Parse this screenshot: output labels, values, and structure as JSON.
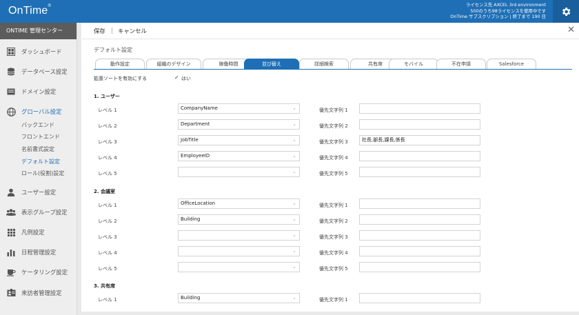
{
  "header": {
    "logo": "OnTime",
    "logo_mark": "®",
    "license_lines": [
      "ライセンス先 AXCEL 3rd environment",
      "500のうち98ライセンスを使用中です",
      "OnTime サブスクリプション | 終了まで 190 日"
    ],
    "settings_icon": "gear-icon"
  },
  "sidebar": {
    "title": "ONTIME 管理センター",
    "items": [
      {
        "label": "ダッシュボード",
        "icon": "dashboard-icon"
      },
      {
        "label": "データベース設定",
        "icon": "database-icon"
      },
      {
        "label": "ドメイン設定",
        "icon": "domain-icon"
      },
      {
        "label": "グローバル設定",
        "icon": "globe-icon"
      },
      {
        "label": "ユーザー設定",
        "icon": "user-icon"
      },
      {
        "label": "表示グループ設定",
        "icon": "group-icon"
      },
      {
        "label": "凡例設定",
        "icon": "legend-icon"
      },
      {
        "label": "日程管理設定",
        "icon": "chart-icon"
      },
      {
        "label": "ケータリング設定",
        "icon": "coffee-icon"
      },
      {
        "label": "来訪者管理設定",
        "icon": "visitor-icon"
      }
    ],
    "subitems": [
      "バックエンド",
      "フロントエンド",
      "名前書式設定",
      "デフォルト設定",
      "ロール(役割)設定"
    ]
  },
  "toolbar": {
    "save": "保存",
    "separator": "|",
    "cancel": "キャンセル",
    "close": "✕"
  },
  "section": {
    "title": "デフォルト設定"
  },
  "tabs": [
    "動作設定",
    "組織のデザイン",
    "稼働時間",
    "並び替え",
    "詳細検索",
    "共有席",
    "モバイル",
    "不在申請",
    "Salesforce"
  ],
  "active_tab": "並び替え",
  "extended_sort": {
    "label": "拡張ソートを有効にする",
    "check": "✓",
    "value": "はい"
  },
  "groups": [
    {
      "title": "1. ユーザー",
      "rows": [
        {
          "level": "レベル 1",
          "value": "CompanyName",
          "pri_label": "優先文字列 1",
          "pri_value": ""
        },
        {
          "level": "レベル 2",
          "value": "Department",
          "pri_label": "優先文字列 2",
          "pri_value": ""
        },
        {
          "level": "レベル 3",
          "value": "JobTitle",
          "pri_label": "優先文字列 3",
          "pri_value": "社長,部長,課長,係長"
        },
        {
          "level": "レベル 4",
          "value": "EmployeeID",
          "pri_label": "優先文字列 4",
          "pri_value": ""
        },
        {
          "level": "レベル 5",
          "value": "",
          "pri_label": "優先文字列 5",
          "pri_value": ""
        }
      ]
    },
    {
      "title": "2. 会議室",
      "rows": [
        {
          "level": "レベル 1",
          "value": "OfficeLocation",
          "pri_label": "優先文字列 1",
          "pri_value": ""
        },
        {
          "level": "レベル 2",
          "value": "Building",
          "pri_label": "優先文字列 2",
          "pri_value": ""
        },
        {
          "level": "レベル 3",
          "value": "",
          "pri_label": "優先文字列 3",
          "pri_value": ""
        },
        {
          "level": "レベル 4",
          "value": "",
          "pri_label": "優先文字列 4",
          "pri_value": ""
        },
        {
          "level": "レベル 5",
          "value": "",
          "pri_label": "優先文字列 5",
          "pri_value": ""
        }
      ]
    },
    {
      "title": "3. 共有席",
      "rows": [
        {
          "level": "レベル 1",
          "value": "Building",
          "pri_label": "優先文字列 1",
          "pri_value": ""
        }
      ]
    }
  ],
  "colors": {
    "accent": "#1f6fb6",
    "sidebar_title_bg": "#5c5c5c"
  }
}
